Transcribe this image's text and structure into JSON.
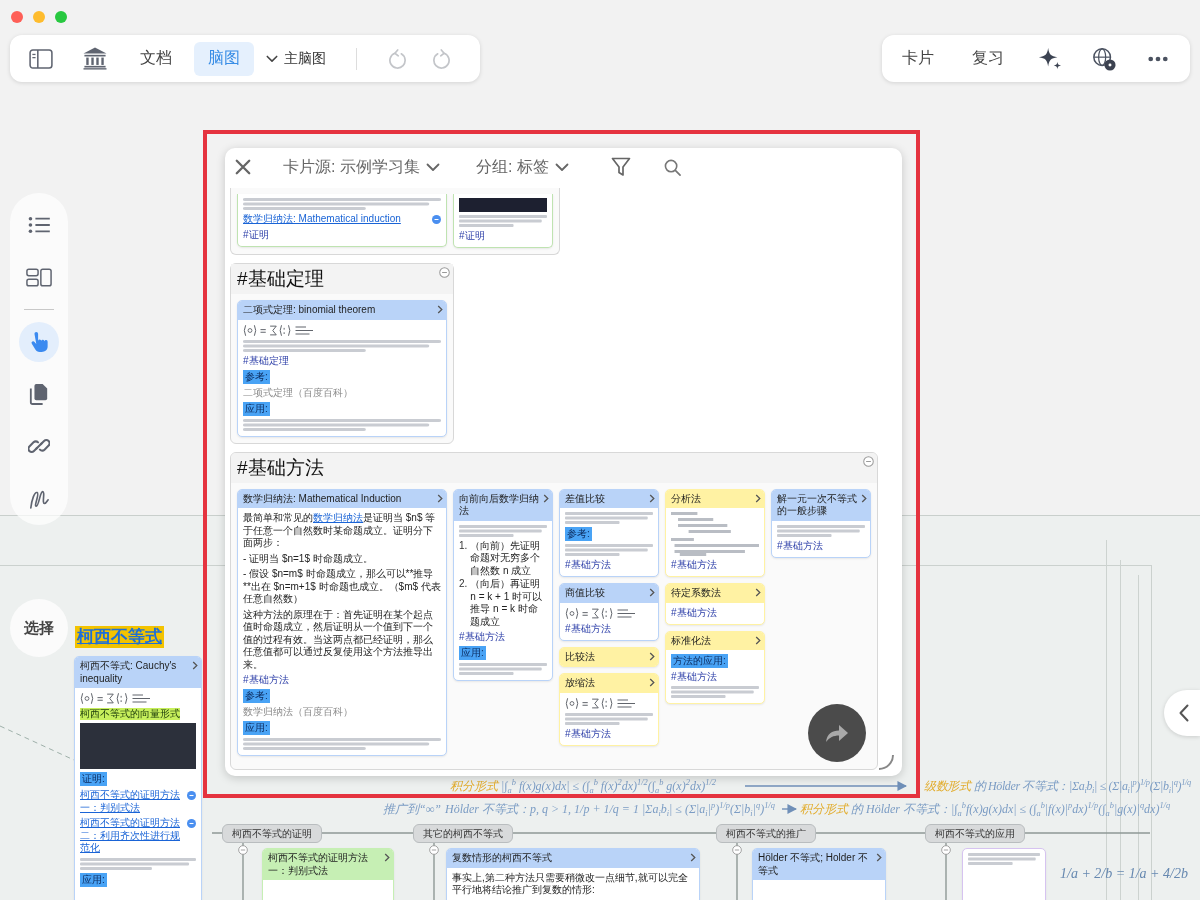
{
  "toolbar": {
    "tabs": [
      {
        "label": "文档",
        "selected": false
      },
      {
        "label": "脑图",
        "selected": true
      }
    ],
    "map_menu": {
      "label": "主脑图"
    },
    "history": [
      {
        "kind": "undo",
        "disabled": true
      },
      {
        "kind": "redo",
        "disabled": true
      }
    ]
  },
  "actions": {
    "buttons": [
      {
        "label": "卡片"
      },
      {
        "label": "复习"
      }
    ]
  },
  "tool_rail": {
    "sections": [
      {
        "items": [
          {
            "kind": "outline",
            "selected": false
          },
          {
            "kind": "layout",
            "selected": false
          }
        ]
      },
      {
        "items": [
          {
            "kind": "pointer",
            "selected": true
          },
          {
            "kind": "pages",
            "selected": false
          },
          {
            "kind": "link",
            "selected": false
          },
          {
            "kind": "pen",
            "selected": false
          }
        ]
      }
    ]
  },
  "select_button": {
    "label": "选择"
  },
  "card_panel": {
    "source_menu": {
      "label": "卡片源: 示例学习集"
    },
    "group_menu": {
      "label": "分组: 标签"
    },
    "groups": [
      {
        "cards": [
          {
            "color": "#bfe3b1",
            "blocks": [
              {
                "kind": "preview"
              },
              {
                "kind": "link",
                "text": "数学归纳法: Mathematical induction"
              },
              {
                "kind": "tag",
                "text": "#证明"
              }
            ]
          },
          {
            "color": "#bfe3b1",
            "blocks": [
              {
                "kind": "picture"
              },
              {
                "kind": "preview"
              },
              {
                "kind": "tag",
                "text": "#证明"
              }
            ]
          }
        ]
      },
      {
        "title": "#基础定理",
        "cards": [
          {
            "title": "二项式定理: binomial theorem",
            "color": "#b9d3f8",
            "blocks": [
              {
                "kind": "formula"
              },
              {
                "kind": "preview"
              },
              {
                "kind": "tag",
                "text": "#基础定理"
              },
              {
                "kind": "label",
                "text": "参考:"
              },
              {
                "kind": "ref",
                "text": "二项式定理（百度百科）"
              },
              {
                "kind": "label",
                "text": "应用:"
              },
              {
                "kind": "preview"
              }
            ]
          }
        ]
      },
      {
        "title": "#基础方法",
        "cards": [
          {
            "title": "数学归纳法: Mathematical Induction",
            "color": "#b9d3f8",
            "blocks": [
              {
                "kind": "text",
                "parts": [
                  {
                    "kind": "plain",
                    "text": "最简单和常见的"
                  },
                  {
                    "kind": "link",
                    "text": "数学归纳法"
                  },
                  {
                    "kind": "plain",
                    "text": "是证明当 $n$ 等于任意一个自然数时某命题成立。证明分下面两步："
                  }
                ]
              },
              {
                "kind": "text",
                "text": "- 证明当 $n=1$ 时命题成立。"
              },
              {
                "kind": "text",
                "text": "- 假设 $n=m$ 时命题成立，那么可以**推导**出在 $n=m+1$ 时命题也成立。（$m$ 代表任意自然数）"
              },
              {
                "kind": "text",
                "text": "这种方法的原理在于：首先证明在某个起点值时命题成立，然后证明从一个值到下一个值的过程有效。当这两点都已经证明，那么任意值都可以通过反复使用这个方法推导出来。"
              },
              {
                "kind": "tag",
                "text": "#基础方法"
              },
              {
                "kind": "label",
                "text": "参考:"
              },
              {
                "kind": "ref",
                "text": "数学归纳法（百度百科）"
              },
              {
                "kind": "label",
                "text": "应用:"
              },
              {
                "kind": "preview"
              }
            ]
          },
          {
            "title": "向前向后数学归纳法",
            "color": "#b9d3f8",
            "blocks": [
              {
                "kind": "preview"
              },
              {
                "kind": "list",
                "items": [
                  {
                    "marker": "1.",
                    "text": "（向前）先证明命题对无穷多个自然数 n 成立"
                  },
                  {
                    "marker": "2.",
                    "text": "（向后）再证明 n = k + 1 时可以推导 n = k 时命题成立"
                  }
                ]
              },
              {
                "kind": "tag",
                "text": "#基础方法"
              },
              {
                "kind": "label",
                "text": "应用:"
              },
              {
                "kind": "preview"
              }
            ]
          },
          {
            "title": "差值比较",
            "color": "#b9d3f8",
            "blocks": [
              {
                "kind": "preview"
              },
              {
                "kind": "label",
                "text": "参考:"
              },
              {
                "kind": "preview"
              },
              {
                "kind": "tag",
                "text": "#基础方法"
              }
            ]
          },
          {
            "title": "商值比较",
            "color": "#b9d3f8",
            "blocks": [
              {
                "kind": "formula"
              },
              {
                "kind": "tag",
                "text": "#基础方法"
              }
            ]
          },
          {
            "title": "比较法",
            "color": "#fff2a3"
          },
          {
            "title": "放缩法",
            "color": "#fff2a3",
            "blocks": [
              {
                "kind": "formula"
              },
              {
                "kind": "preview"
              },
              {
                "kind": "tag",
                "text": "#基础方法"
              }
            ]
          },
          {
            "title": "分析法",
            "color": "#fff2a3",
            "blocks": [
              {
                "kind": "figure"
              },
              {
                "kind": "tag",
                "text": "#基础方法"
              }
            ]
          },
          {
            "title": "待定系数法",
            "color": "#fff2a3",
            "blocks": [
              {
                "kind": "tag",
                "text": "#基础方法"
              }
            ]
          },
          {
            "title": "标准化法",
            "color": "#fff2a3",
            "blocks": [
              {
                "kind": "label",
                "text": "方法的应用:"
              },
              {
                "kind": "tag",
                "text": "#基础方法"
              },
              {
                "kind": "preview"
              }
            ]
          },
          {
            "title": "解一元一次不等式的一般步骤",
            "color": "#b9d3f8",
            "blocks": [
              {
                "kind": "preview"
              },
              {
                "kind": "tag",
                "text": "#基础方法"
              }
            ]
          }
        ]
      }
    ]
  },
  "mind_map": {
    "topic": {
      "label": "柯西不等式"
    },
    "topic_card": {
      "title": "柯西不等式: Cauchy's inequality",
      "color": "#b9d3f8",
      "blocks": [
        {
          "kind": "formula"
        },
        {
          "kind": "highlight",
          "text": "柯西不等式的向量形式"
        },
        {
          "kind": "video"
        },
        {
          "kind": "label",
          "text": "证明:"
        },
        {
          "kind": "link",
          "text": "柯西不等式的证明方法一：判别式法"
        },
        {
          "kind": "link",
          "text": "柯西不等式的证明方法二：利用齐次性进行规范化"
        },
        {
          "kind": "preview"
        },
        {
          "kind": "label",
          "text": "应用:"
        }
      ]
    },
    "notes": [
      {
        "parts": [
          {
            "text": "积分形式",
            "color": "#e2ac2c"
          },
          {
            "text": "|∫$_{a}$$^{b}$ f(x)g(x)dx| ≤ (∫$_{a}$$^{b}$ f(x)$^{2}$dx)$^{1/2}$(∫$_{a}$$^{b}$ g(x)$^{2}$dx)$^{1/2}$",
            "color": "#7b9cc4"
          }
        ]
      },
      {
        "parts": [
          {
            "text": "级数形式",
            "color": "#e2ac2c"
          },
          {
            "text": "的 Hölder 不等式：|Σa$_{i}$b$_{i}$| ≤ (Σ|a$_{i}$|$^{p}$)$^{1/p}$(Σ|b$_{i}$|$^{q}$)$^{1/q}$",
            "color": "#7b9cc4"
          }
        ]
      },
      {
        "parts": [
          {
            "text": "推广到“∞”",
            "color": "#7b9cc4"
          }
        ]
      },
      {
        "parts": [
          {
            "text": "Hölder 不等式：p, q > 1, 1/p + 1/q = 1  |Σa$_{i}$b$_{i}$| ≤ (Σ|a$_{i}$|$^{p}$)$^{1/p}$(Σ|b$_{i}$|$^{q}$)$^{1/q}$",
            "color": "#7b9cc4"
          }
        ]
      },
      {
        "parts": [
          {
            "text": "积分形式",
            "color": "#e2ac2c"
          },
          {
            "text": "的 Hölder 不等式：|∫$_{a}$$^{b}$f(x)g(x)dx| ≤ (∫$_{a}$$^{b}$|f(x)|$^{p}$dx)$^{1/p}$(∫$_{a}$$^{b}$|g(x)|$^{q}$dx)$^{1/q}$",
            "color": "#7b9cc4"
          }
        ]
      },
      {
        "parts": [
          {
            "text": "1/a + 2/b = 1/a + 4/2b",
            "color": "#6688b0"
          }
        ]
      }
    ],
    "branches": [
      {
        "label": "柯西不等式的证明",
        "cards": [
          {
            "title": "柯西不等式的证明方法一：判别式法",
            "color": "#c6efb4"
          }
        ]
      },
      {
        "label": "其它的柯西不等式",
        "cards": [
          {
            "title": "复数情形的柯西不等式",
            "color": "#b9d3f8",
            "blocks": [
              {
                "kind": "text",
                "text": "事实上,第二种方法只需要稍微改一点细节,就可以完全平行地将结论推广到复数的情形:"
              }
            ]
          }
        ]
      },
      {
        "label": "柯西不等式的推广",
        "cards": [
          {
            "title": "Hölder 不等式; Holder 不等式",
            "color": "#b9d3f8"
          }
        ]
      },
      {
        "label": "柯西不等式的应用",
        "cards": [
          {
            "color": "#d6c3f0",
            "blocks": [
              {
                "kind": "preview"
              }
            ]
          }
        ]
      }
    ]
  }
}
